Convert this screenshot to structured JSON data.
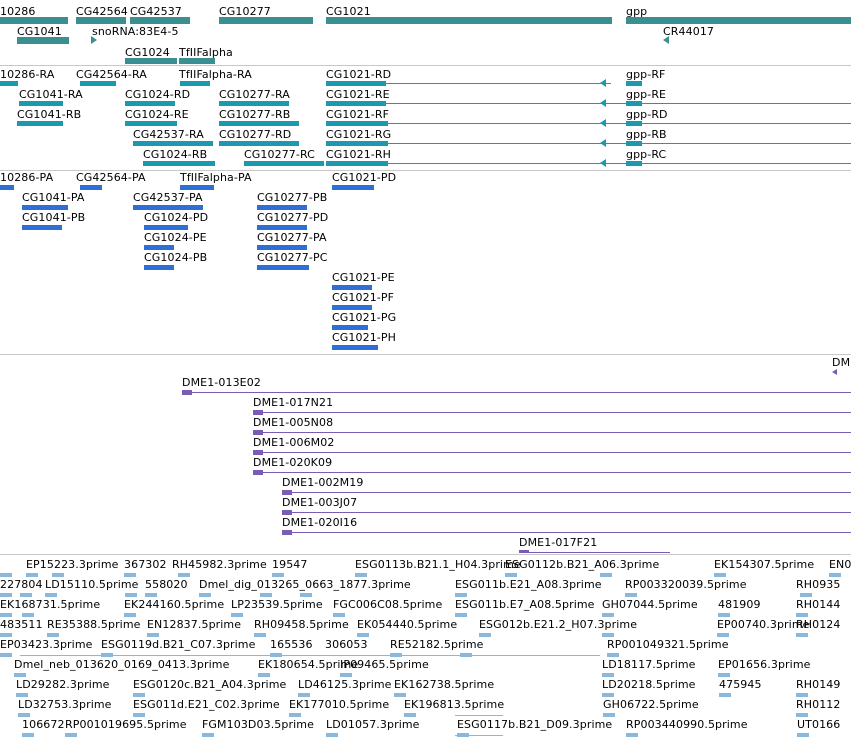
{
  "colors": {
    "gene": "#3a9090",
    "transcript": "#1a9ab0",
    "protein": "#2f6ed6",
    "clone": "#7a5cb4",
    "est": "#8ab8dc"
  },
  "genes": [
    {
      "label": "10286"
    },
    {
      "label": "CG42564"
    },
    {
      "label": "CG42537"
    },
    {
      "label": "CG10277"
    },
    {
      "label": "CG1021"
    },
    {
      "label": "gpp"
    },
    {
      "label": "CG1041"
    },
    {
      "label": "snoRNA:83E4-5"
    },
    {
      "label": "CR44017"
    },
    {
      "label": "CG1024"
    },
    {
      "label": "TfIIFalpha"
    }
  ],
  "transcripts": [
    {
      "label": "10286-RA"
    },
    {
      "label": "CG42564-RA"
    },
    {
      "label": "TfIIFalpha-RA"
    },
    {
      "label": "CG1021-RD"
    },
    {
      "label": "gpp-RF"
    },
    {
      "label": "CG1041-RA"
    },
    {
      "label": "CG1024-RD"
    },
    {
      "label": "CG10277-RA"
    },
    {
      "label": "CG1021-RE"
    },
    {
      "label": "gpp-RE"
    },
    {
      "label": "CG1041-RB"
    },
    {
      "label": "CG1024-RE"
    },
    {
      "label": "CG10277-RB"
    },
    {
      "label": "CG1021-RF"
    },
    {
      "label": "gpp-RD"
    },
    {
      "label": "CG42537-RA"
    },
    {
      "label": "CG10277-RD"
    },
    {
      "label": "CG1021-RG"
    },
    {
      "label": "gpp-RB"
    },
    {
      "label": "CG1024-RB"
    },
    {
      "label": "CG10277-RC"
    },
    {
      "label": "CG1021-RH"
    },
    {
      "label": "gpp-RC"
    }
  ],
  "proteins": [
    {
      "label": "10286-PA"
    },
    {
      "label": "CG42564-PA"
    },
    {
      "label": "TfIIFalpha-PA"
    },
    {
      "label": "CG1021-PD"
    },
    {
      "label": "CG1041-PA"
    },
    {
      "label": "CG42537-PA"
    },
    {
      "label": "CG10277-PB"
    },
    {
      "label": "CG1041-PB"
    },
    {
      "label": "CG1024-PD"
    },
    {
      "label": "CG10277-PD"
    },
    {
      "label": "CG1024-PE"
    },
    {
      "label": "CG10277-PA"
    },
    {
      "label": "CG1024-PB"
    },
    {
      "label": "CG10277-PC"
    },
    {
      "label": "CG1021-PE"
    },
    {
      "label": "CG1021-PF"
    },
    {
      "label": "CG1021-PG"
    },
    {
      "label": "CG1021-PH"
    }
  ],
  "clones": [
    {
      "label": "DME1-013E02"
    },
    {
      "label": "DME1-017N21"
    },
    {
      "label": "DME1-005N08"
    },
    {
      "label": "DME1-006M02"
    },
    {
      "label": "DME1-020K09"
    },
    {
      "label": "DME1-002M19"
    },
    {
      "label": "DME1-003J07"
    },
    {
      "label": "DME1-020I16"
    },
    {
      "label": "DME1-017F21"
    },
    {
      "label": "DME"
    }
  ],
  "ests": [
    {
      "label": "EP15223.3prime"
    },
    {
      "label": "367302"
    },
    {
      "label": "RH45982.3prime"
    },
    {
      "label": "19547"
    },
    {
      "label": "ESG0113b.B21.1_H04.3prime"
    },
    {
      "label": "ESG0112b.B21_A06.3prime"
    },
    {
      "label": "EK154307.5prime"
    },
    {
      "label": "EN0"
    },
    {
      "label": "227804"
    },
    {
      "label": "LD15110.5prime"
    },
    {
      "label": "558020"
    },
    {
      "label": "Dmel_dig_013265_0663_1877.3prime"
    },
    {
      "label": "ESG011b.E21_A08.3prime"
    },
    {
      "label": "RP003320039.5prime"
    },
    {
      "label": "RH0935"
    },
    {
      "label": "EK168731.5prime"
    },
    {
      "label": "EK244160.5prime"
    },
    {
      "label": "LP23539.5prime"
    },
    {
      "label": "FGC006C08.5prime"
    },
    {
      "label": "ESG011b.E7_A08.5prime"
    },
    {
      "label": "GH07044.5prime"
    },
    {
      "label": "481909"
    },
    {
      "label": "RH0144"
    },
    {
      "label": "483511"
    },
    {
      "label": "RE35388.5prime"
    },
    {
      "label": "EN12837.5prime"
    },
    {
      "label": "RH09458.5prime"
    },
    {
      "label": "EK054440.5prime"
    },
    {
      "label": "ESG012b.E21.2_H07.3prime"
    },
    {
      "label": "EP00740.3prime"
    },
    {
      "label": "RH0124"
    },
    {
      "label": "EP03423.3prime"
    },
    {
      "label": "ESG0119d.B21_C07.3prime"
    },
    {
      "label": "165536"
    },
    {
      "label": "306053"
    },
    {
      "label": "RE52182.5prime"
    },
    {
      "label": "RP001049321.5prime"
    },
    {
      "label": "Dmel_neb_013620_0169_0413.3prime"
    },
    {
      "label": "EK180654.5prime"
    },
    {
      "label": "IP09465.5prime"
    },
    {
      "label": "LD18117.5prime"
    },
    {
      "label": "EP01656.3prime"
    },
    {
      "label": "LD29282.3prime"
    },
    {
      "label": "ESG0120c.B21_A04.3prime"
    },
    {
      "label": "LD46125.3prime"
    },
    {
      "label": "EK162738.5prime"
    },
    {
      "label": "LD20218.5prime"
    },
    {
      "label": "475945"
    },
    {
      "label": "RH0149"
    },
    {
      "label": "LD32753.3prime"
    },
    {
      "label": "ESG011d.E21_C02.3prime"
    },
    {
      "label": "EK177010.5prime"
    },
    {
      "label": "EK196813.5prime"
    },
    {
      "label": "GH06722.5prime"
    },
    {
      "label": "RH0112"
    },
    {
      "label": "106672"
    },
    {
      "label": "RP001019695.5prime"
    },
    {
      "label": "FGM103D03.5prime"
    },
    {
      "label": "LD01057.3prime"
    },
    {
      "label": "ESG0117b.B21_D09.3prime"
    },
    {
      "label": "RP003440990.5prime"
    },
    {
      "label": "UT0166"
    }
  ]
}
